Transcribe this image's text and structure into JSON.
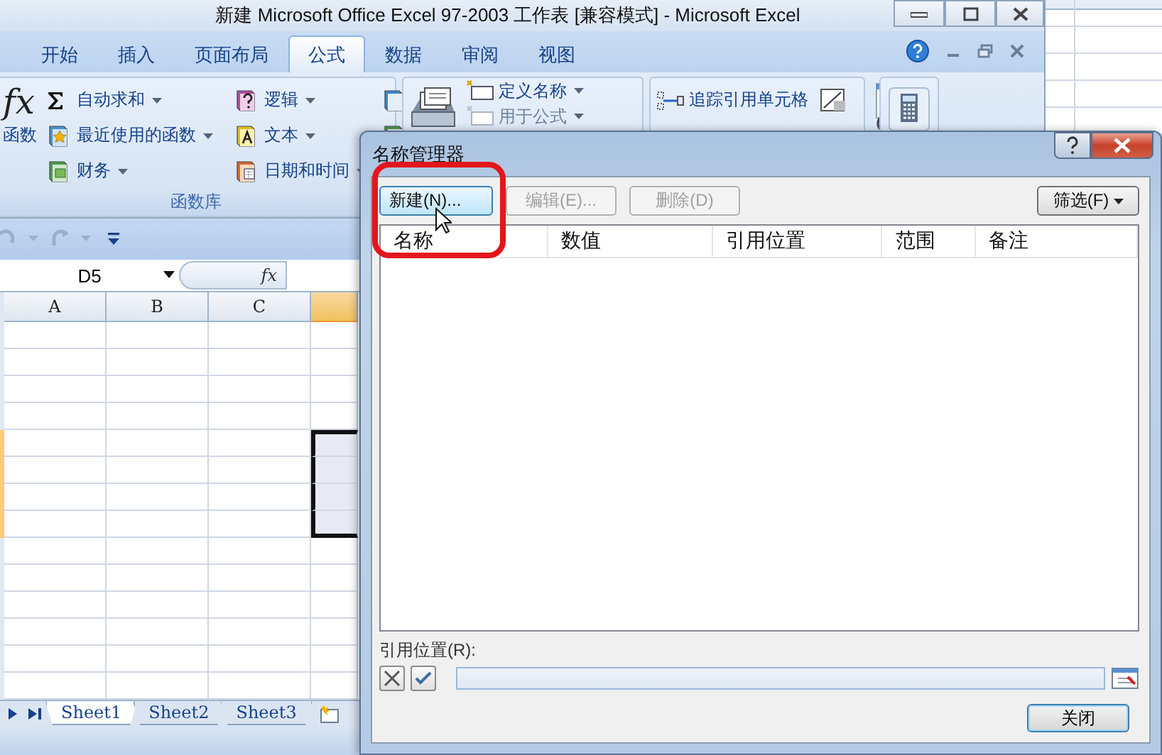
{
  "window": {
    "title": "新建 Microsoft Office Excel 97-2003 工作表  [兼容模式] - Microsoft Excel"
  },
  "ribbon_tabs": [
    {
      "label": "开始",
      "selected": false
    },
    {
      "label": "插入",
      "selected": false
    },
    {
      "label": "页面布局",
      "selected": false
    },
    {
      "label": "公式",
      "selected": true
    },
    {
      "label": "数据",
      "selected": false
    },
    {
      "label": "审阅",
      "selected": false
    },
    {
      "label": "视图",
      "selected": false
    }
  ],
  "ribbon": {
    "insert_function": {
      "symbol": "fx",
      "label": "函数"
    },
    "function_columns": [
      [
        {
          "label": "自动求和"
        },
        {
          "label": "最近使用的函数"
        },
        {
          "label": "财务"
        }
      ],
      [
        {
          "label": "逻辑"
        },
        {
          "label": "文本"
        },
        {
          "label": "日期和时间"
        }
      ]
    ],
    "function_group_label": "函数库",
    "names": [
      {
        "label": "定义名称",
        "disabled": false
      },
      {
        "label": "用于公式",
        "disabled": true
      }
    ],
    "auditing": [
      {
        "label": "追踪引用单元格"
      }
    ]
  },
  "formula_bar": {
    "name_box": "D5",
    "function_button": "fx"
  },
  "columns": [
    {
      "label": "A",
      "selected": false
    },
    {
      "label": "B",
      "selected": false
    },
    {
      "label": "C",
      "selected": false
    },
    {
      "selected": true
    }
  ],
  "rows": [
    {
      "selected": false
    },
    {
      "selected": false
    },
    {
      "selected": false
    },
    {
      "selected": false
    },
    {
      "selected": true
    },
    {
      "selected": true
    },
    {
      "selected": true
    },
    {
      "selected": true
    },
    {
      "selected": false
    },
    {
      "selected": false
    },
    {
      "selected": false
    },
    {
      "selected": false
    },
    {
      "selected": false
    },
    {
      "selected": false
    }
  ],
  "sheet_tabs": [
    {
      "label": "Sheet1",
      "selected": true
    },
    {
      "label": "Sheet2",
      "selected": false
    },
    {
      "label": "Sheet3",
      "selected": false
    }
  ],
  "dialog": {
    "title": "名称管理器",
    "buttons": [
      {
        "label": "新建(N)...",
        "disabled": false
      },
      {
        "label": "编辑(E)...",
        "disabled": true
      },
      {
        "label": "删除(D)",
        "disabled": true
      }
    ],
    "filter_button": "筛选(F)",
    "columns": [
      "名称",
      "数值",
      "引用位置",
      "范围",
      "备注"
    ],
    "refers_to_label": "引用位置(R):",
    "close_button": "关闭"
  }
}
